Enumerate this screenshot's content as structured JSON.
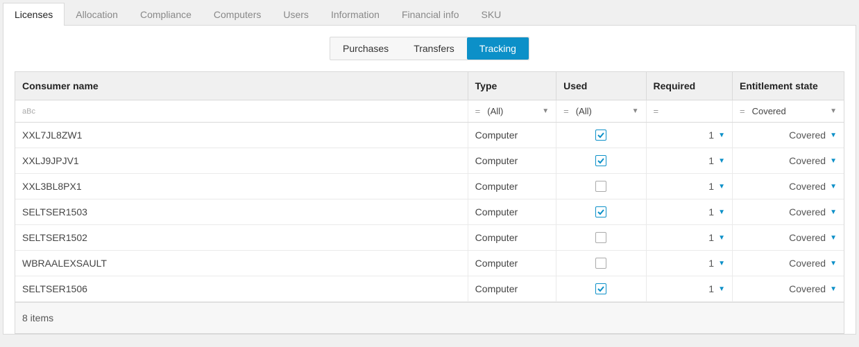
{
  "tabs": [
    "Licenses",
    "Allocation",
    "Compliance",
    "Computers",
    "Users",
    "Information",
    "Financial info",
    "SKU"
  ],
  "activeTab": 0,
  "subtabs": [
    "Purchases",
    "Transfers",
    "Tracking"
  ],
  "activeSubtab": 2,
  "columns": {
    "name": "Consumer name",
    "type": "Type",
    "used": "Used",
    "req": "Required",
    "ent": "Entitlement state"
  },
  "filters": {
    "name_placeholder": "aBc",
    "type_value": "(All)",
    "used_value": "(All)",
    "req_value": "",
    "ent_value": "Covered"
  },
  "rows": [
    {
      "name": "XXL7JL8ZW1",
      "type": "Computer",
      "used": true,
      "req": "1",
      "ent": "Covered"
    },
    {
      "name": "XXLJ9JPJV1",
      "type": "Computer",
      "used": true,
      "req": "1",
      "ent": "Covered"
    },
    {
      "name": "XXL3BL8PX1",
      "type": "Computer",
      "used": false,
      "req": "1",
      "ent": "Covered"
    },
    {
      "name": "SELTSER1503",
      "type": "Computer",
      "used": true,
      "req": "1",
      "ent": "Covered"
    },
    {
      "name": "SELTSER1502",
      "type": "Computer",
      "used": false,
      "req": "1",
      "ent": "Covered"
    },
    {
      "name": "WBRAALEXSAULT",
      "type": "Computer",
      "used": false,
      "req": "1",
      "ent": "Covered"
    },
    {
      "name": "SELTSER1506",
      "type": "Computer",
      "used": true,
      "req": "1",
      "ent": "Covered"
    }
  ],
  "footer": "8 items"
}
